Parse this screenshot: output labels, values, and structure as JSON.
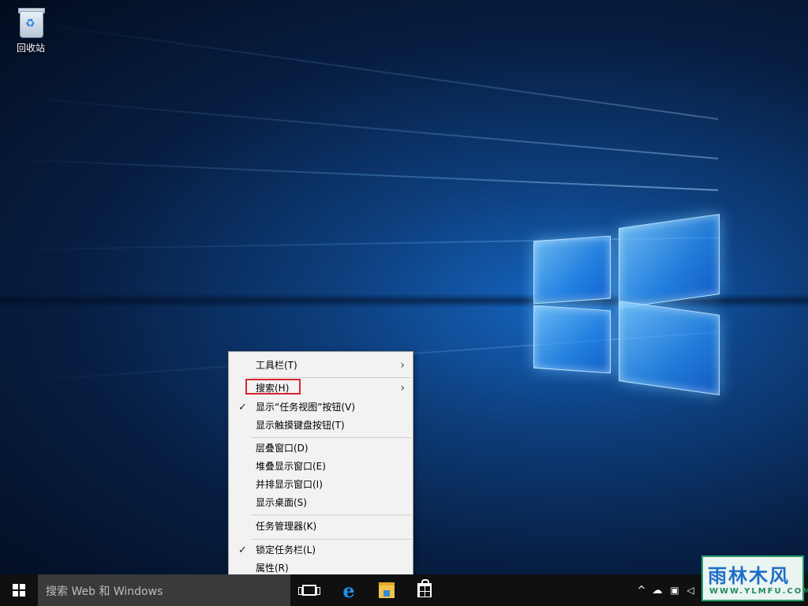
{
  "desktop": {
    "icons": [
      {
        "label": "回收站",
        "icon": "recycle-bin-icon"
      }
    ]
  },
  "context_menu": {
    "items": [
      {
        "label": "工具栏(T)",
        "checked": false,
        "submenu": true
      },
      {
        "label": "搜索(H)",
        "checked": false,
        "submenu": true,
        "highlighted": true
      },
      {
        "label": "显示“任务视图”按钮(V)",
        "checked": true,
        "submenu": false
      },
      {
        "label": "显示触摸键盘按钮(T)",
        "checked": false,
        "submenu": false
      },
      {
        "label": "层叠窗口(D)",
        "checked": false,
        "submenu": false
      },
      {
        "label": "堆叠显示窗口(E)",
        "checked": false,
        "submenu": false
      },
      {
        "label": "并排显示窗口(I)",
        "checked": false,
        "submenu": false
      },
      {
        "label": "显示桌面(S)",
        "checked": false,
        "submenu": false
      },
      {
        "label": "任务管理器(K)",
        "checked": false,
        "submenu": false
      },
      {
        "label": "锁定任务栏(L)",
        "checked": true,
        "submenu": false
      },
      {
        "label": "属性(R)",
        "checked": false,
        "submenu": false
      }
    ],
    "check_glyph": "✓",
    "arrow_glyph": "›",
    "highlight_color": "#d9252c"
  },
  "taskbar": {
    "search_placeholder": "搜索 Web 和 Windows",
    "pinned": [
      "task-view-icon",
      "edge-icon",
      "file-explorer-icon",
      "store-icon"
    ],
    "tray": {
      "chevron": "^",
      "icons": [
        "onedrive-icon",
        "network-icon",
        "volume-icon"
      ]
    }
  },
  "watermark": {
    "main": "雨林木风",
    "sub": "WWW.YLMFU.COM"
  },
  "colors": {
    "taskbar": "#101010",
    "search_box": "#3a3a3a",
    "accent": "#1e90e8"
  }
}
